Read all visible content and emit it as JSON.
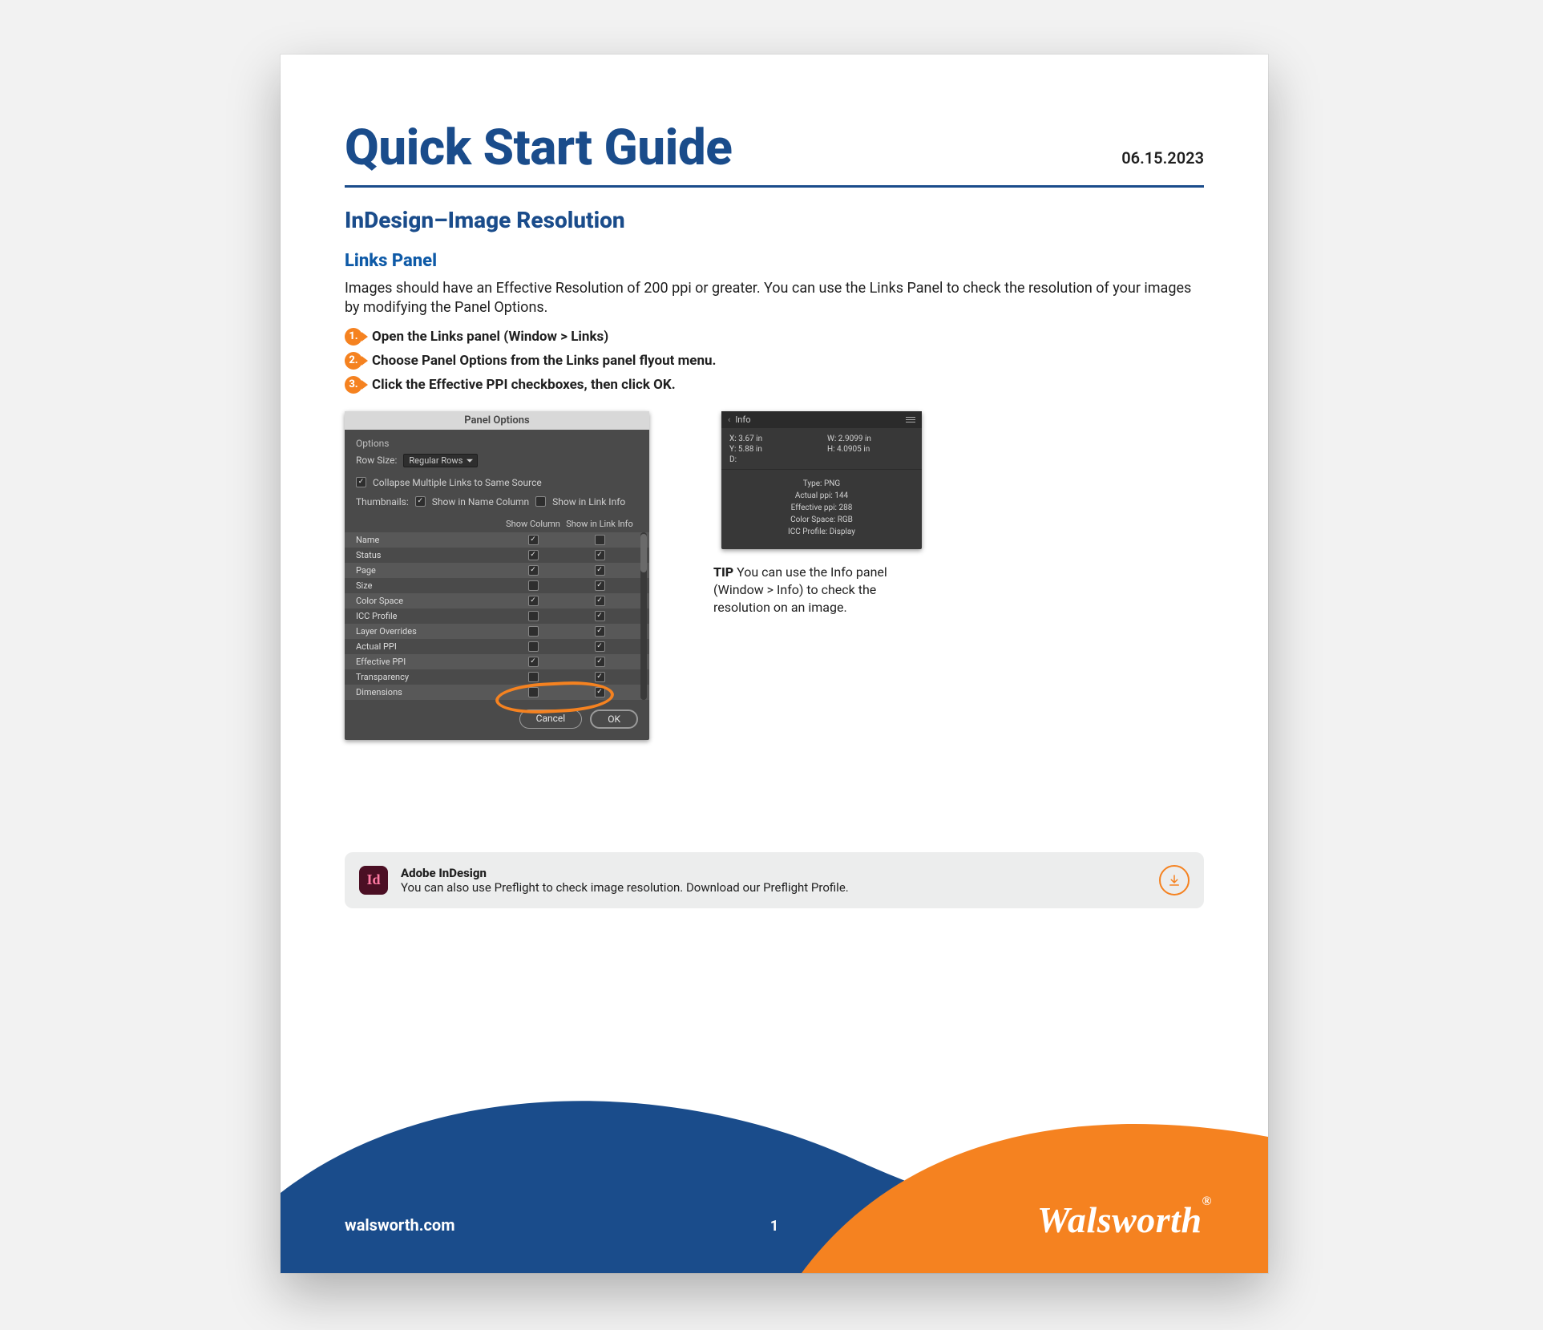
{
  "colors": {
    "brand_blue": "#1a4c8b",
    "brand_orange": "#f58220",
    "panel_bg": "#4a4a4a",
    "info_bg": "#383838"
  },
  "header": {
    "title": "Quick Start Guide",
    "date": "06.15.2023",
    "subtitle": "InDesign–Image Resolution",
    "section": "Links Panel"
  },
  "intro": "Images should have an Effective Resolution of 200 ppi or greater. You can use the Links Panel to check the resolution of your images by modifying the Panel Options.",
  "steps": [
    {
      "n": "1.",
      "label": "Open the Links panel (Window > Links)"
    },
    {
      "n": "2.",
      "label": "Choose Panel Options from the Links panel flyout menu."
    },
    {
      "n": "3.",
      "label": "Click the Effective PPI checkboxes, then click OK."
    }
  ],
  "panel": {
    "title": "Panel Options",
    "options_label": "Options",
    "row_size_label": "Row Size:",
    "row_size_value": "Regular Rows",
    "collapse_label": "Collapse Multiple Links to Same Source",
    "collapse_checked": true,
    "thumb_label": "Thumbnails:",
    "thumb_show_name_label": "Show in Name Column",
    "thumb_show_name_checked": true,
    "thumb_show_link_label": "Show in Link Info",
    "thumb_show_link_checked": false,
    "col_show": "Show Column",
    "col_link": "Show in Link Info",
    "rows": [
      {
        "name": "Name",
        "show": true,
        "link": false
      },
      {
        "name": "Status",
        "show": true,
        "link": true
      },
      {
        "name": "Page",
        "show": true,
        "link": true
      },
      {
        "name": "Size",
        "show": false,
        "link": true
      },
      {
        "name": "Color Space",
        "show": true,
        "link": true
      },
      {
        "name": "ICC Profile",
        "show": false,
        "link": true
      },
      {
        "name": "Layer Overrides",
        "show": false,
        "link": true
      },
      {
        "name": "Actual PPI",
        "show": false,
        "link": true
      },
      {
        "name": "Effective PPI",
        "show": true,
        "link": true
      },
      {
        "name": "Transparency",
        "show": false,
        "link": true
      },
      {
        "name": "Dimensions",
        "show": false,
        "link": true
      }
    ],
    "cancel": "Cancel",
    "ok": "OK"
  },
  "info": {
    "tab": "Info",
    "x_label": "X:",
    "x_val": "3.67 in",
    "y_label": "Y:",
    "y_val": "5.88 in",
    "w_label": "W:",
    "w_val": "2.9099 in",
    "h_label": "H:",
    "h_val": "4.0905 in",
    "d_label": "D:",
    "type": "Type: PNG",
    "actual": "Actual ppi: 144",
    "effective": "Effective ppi: 288",
    "space": "Color Space: RGB",
    "icc": "ICC Profile: Display"
  },
  "tip_bold": "TIP",
  "tip_text": " You can use the Info panel (Window > Info) to check the resolution on an image.",
  "preflight": {
    "badge": "Id",
    "heading": "Adobe InDesign",
    "text": "You can also use Preflight to check image resolution. Download our Preflight Profile."
  },
  "footer": {
    "url": "walsworth.com",
    "page": "1",
    "brand": "Walsworth",
    "reg": "®"
  }
}
